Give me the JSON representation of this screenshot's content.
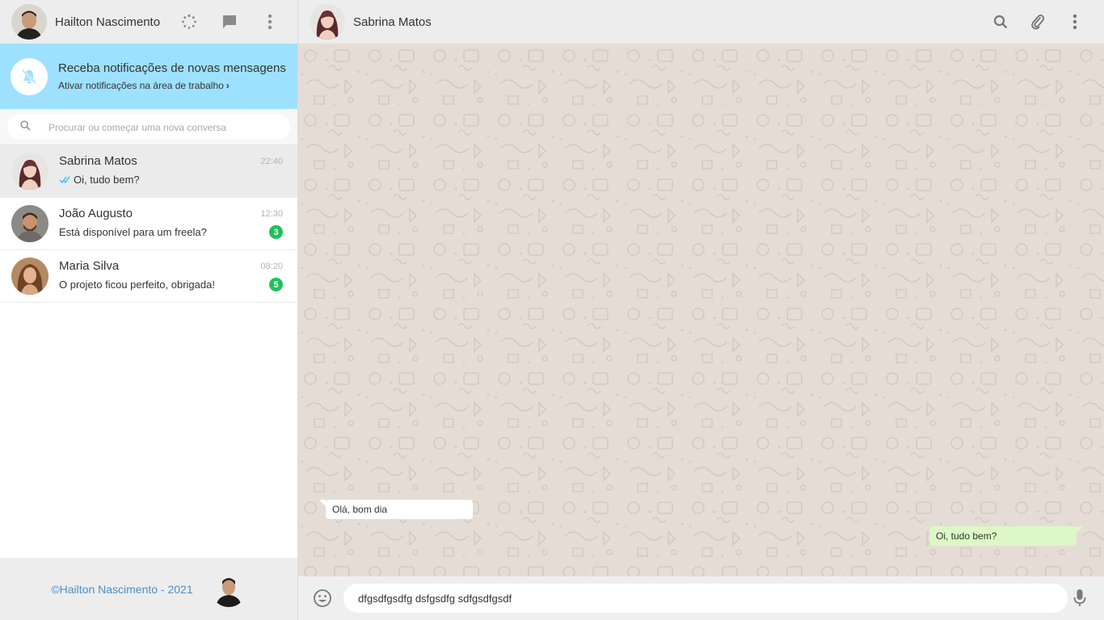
{
  "sidebar": {
    "user": {
      "name": "Hailton Nascimento"
    },
    "header_icons": [
      "status-icon",
      "new-chat-icon",
      "menu-icon"
    ],
    "notification": {
      "title": "Receba notificações de novas mensagens",
      "link": "Ativar notificações na área de trabalho",
      "link_chevron": "›"
    },
    "search": {
      "placeholder": "Procurar ou começar uma nova conversa",
      "value": ""
    },
    "chats": [
      {
        "name": "Sabrina Matos",
        "last_message": "Oi, tudo bem?",
        "time": "22:40",
        "badge": "",
        "read": true,
        "active": true
      },
      {
        "name": "João Augusto",
        "last_message": "Está disponível para um freela?",
        "time": "12:30",
        "badge": "3",
        "read": false,
        "active": false
      },
      {
        "name": "Maria Silva",
        "last_message": "O projeto ficou perfeito, obrigada!",
        "time": "08:20",
        "badge": "5",
        "read": false,
        "active": false
      }
    ],
    "footer": {
      "text": "©Hailton Nascimento - 2021"
    }
  },
  "chat": {
    "contact": {
      "name": "Sabrina Matos"
    },
    "header_icons": [
      "search-icon",
      "attach-icon",
      "menu-icon"
    ],
    "messages": [
      {
        "direction": "in",
        "text": "Olá, bom dia"
      },
      {
        "direction": "out",
        "text": "Oi, tudo bem?"
      }
    ],
    "compose": {
      "value": "dfgsdfgsdfg dsfgsdfg sdfgsdfgsdf"
    }
  },
  "colors": {
    "header_bg": "#ededed",
    "notification_bg": "#9de1fe",
    "chat_bg": "#e5ddd5",
    "outgoing_bubble": "#dcf8c6",
    "badge": "#1ec15b",
    "footer_text": "#4a90c6",
    "read_check": "#4fc3f7"
  }
}
